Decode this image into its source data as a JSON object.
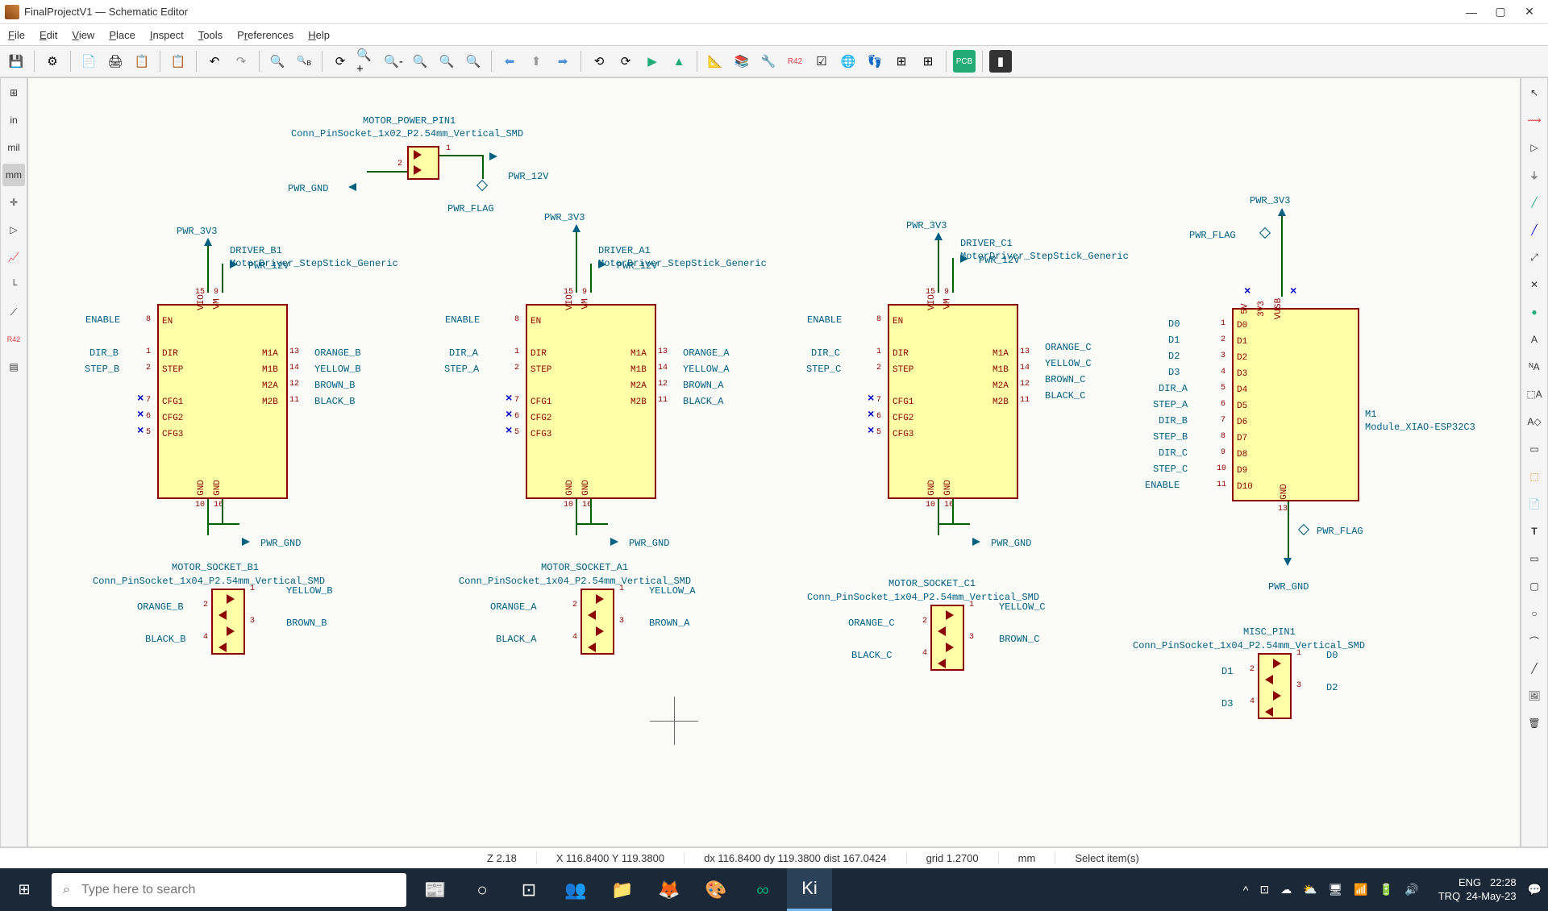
{
  "window": {
    "title": "FinalProjectV1 — Schematic Editor"
  },
  "menu": {
    "file": "File",
    "edit": "Edit",
    "view": "View",
    "place": "Place",
    "inspect": "Inspect",
    "tools": "Tools",
    "prefs": "Preferences",
    "help": "Help"
  },
  "lside": {
    "in": "in",
    "mil": "mil",
    "mm": "mm"
  },
  "status": {
    "zoom": "Z 2.18",
    "xy": "X 116.8400  Y 119.3800",
    "dxy": "dx 116.8400  dy 119.3800  dist 167.0424",
    "grid": "grid 1.2700",
    "unit": "mm",
    "hint": "Select item(s)"
  },
  "taskbar": {
    "search": "Type here to search",
    "lang": "ENG",
    "kbd": "TRQ",
    "time": "22:28",
    "date": "24-May-23"
  },
  "labels": {
    "motor_power_pin": "MOTOR_POWER_PIN1",
    "conn_1x02": "Conn_PinSocket_1x02_P2.54mm_Vertical_SMD",
    "conn_1x04": "Conn_PinSocket_1x04_P2.54mm_Vertical_SMD",
    "pwr_gnd": "PWR_GND",
    "pwr_12v": "PWR_12V",
    "pwr_3v3": "PWR_3V3",
    "pwr_flag": "PWR_FLAG",
    "driver_b": "DRIVER_B1",
    "driver_a": "DRIVER_A1",
    "driver_c": "DRIVER_C1",
    "driver_type": "MotorDriver_StepStick_Generic",
    "en": "EN",
    "dir": "DIR",
    "step": "STEP",
    "cfg1": "CFG1",
    "cfg2": "CFG2",
    "cfg3": "CFG3",
    "m1a": "M1A",
    "m1b": "M1B",
    "m2a": "M2A",
    "m2b": "M2B",
    "gnd": "GND",
    "vio": "VIO",
    "vm": "VM",
    "enable": "ENABLE",
    "dir_a": "DIR_A",
    "step_a": "STEP_A",
    "dir_b": "DIR_B",
    "step_b": "STEP_B",
    "dir_c": "DIR_C",
    "step_c": "STEP_C",
    "orange_a": "ORANGE_A",
    "yellow_a": "YELLOW_A",
    "brown_a": "BROWN_A",
    "black_a": "BLACK_A",
    "orange_b": "ORANGE_B",
    "yellow_b": "YELLOW_B",
    "brown_b": "BROWN_B",
    "black_b": "BLACK_B",
    "orange_c": "ORANGE_C",
    "yellow_c": "YELLOW_C",
    "brown_c": "BROWN_C",
    "black_c": "BLACK_C",
    "socket_a": "MOTOR_SOCKET_A1",
    "socket_b": "MOTOR_SOCKET_B1",
    "socket_c": "MOTOR_SOCKET_C1",
    "misc_pin": "MISC_PIN1",
    "m1": "M1",
    "m1_type": "Module_XIAO-ESP32C3",
    "d0": "D0",
    "d1": "D1",
    "d2": "D2",
    "d3": "D3",
    "d4": "D4",
    "d5": "D5",
    "d6": "D6",
    "d7": "D7",
    "d8": "D8",
    "d9": "D9",
    "d10": "D10",
    "vusb": "VUSB",
    "v3v3": "3V3",
    "v5v": "5V"
  }
}
